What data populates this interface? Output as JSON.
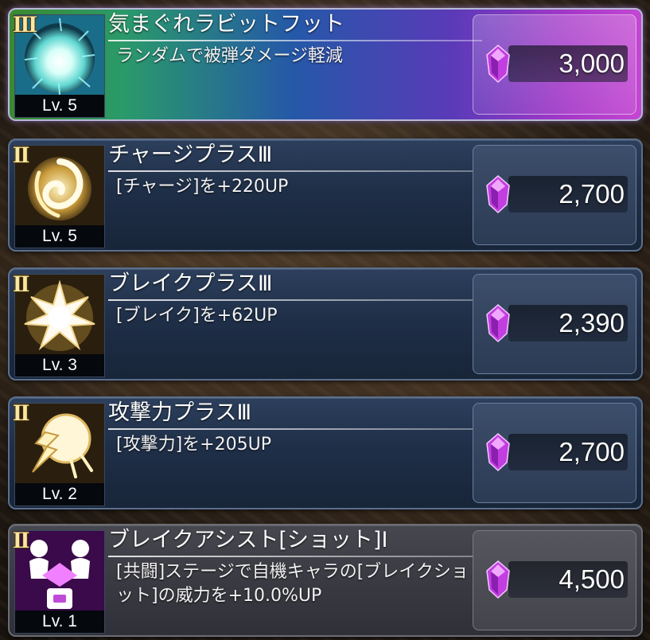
{
  "colors": {
    "card_blue": "#1f2f48",
    "card_gray": "#3a3a42",
    "gem_purple": "#c23ee0",
    "rank_gold": "#f7e7a2"
  },
  "skills": [
    {
      "rank": "III",
      "title": "気まぐれラビットフット",
      "description": "ランダムで被弾ダメージ軽減",
      "level": "Lv. 5",
      "price": "3,000",
      "icon": "burst-orb-icon"
    },
    {
      "rank": "II",
      "title": "チャージプラスⅢ",
      "description": "[チャージ]を+220UP",
      "level": "Lv. 5",
      "price": "2,700",
      "icon": "swirl-icon"
    },
    {
      "rank": "II",
      "title": "ブレイクプラスⅢ",
      "description": "[ブレイク]を+62UP",
      "level": "Lv. 3",
      "price": "2,390",
      "icon": "break-burst-icon"
    },
    {
      "rank": "II",
      "title": "攻撃力プラスⅢ",
      "description": "[攻撃力]を+205UP",
      "level": "Lv. 2",
      "price": "2,700",
      "icon": "cracked-orb-icon"
    },
    {
      "rank": "II",
      "title": "ブレイクアシスト[ショット]Ⅰ",
      "description": "[共闘]ステージで自機キャラの[ブレイクショット]の威力を+10.0%UP",
      "level": "Lv. 1",
      "price": "4,500",
      "icon": "assist-figures-icon"
    }
  ]
}
